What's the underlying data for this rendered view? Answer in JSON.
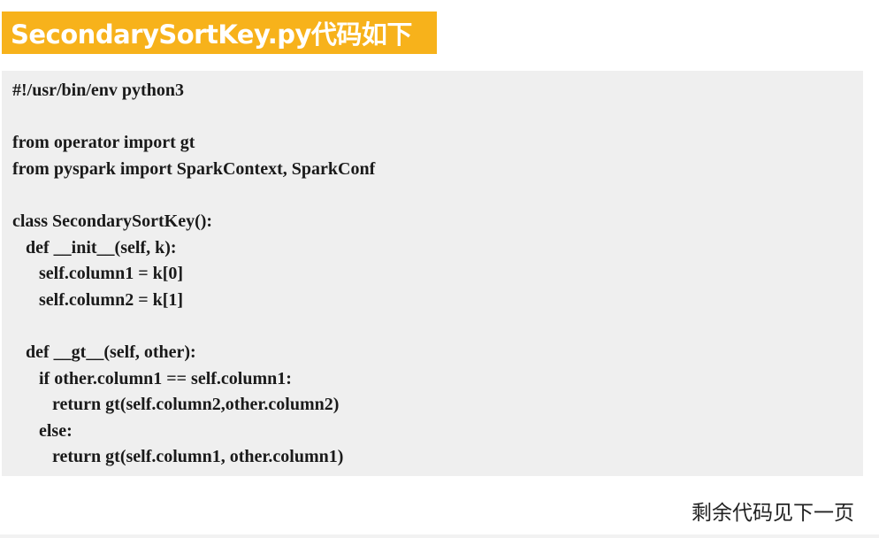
{
  "title": "SecondarySortKey.py代码如下",
  "code": {
    "lines": [
      "#!/usr/bin/env python3",
      "",
      "from operator import gt",
      "from pyspark import SparkContext, SparkConf",
      "",
      "class SecondarySortKey():",
      "   def __init__(self, k):",
      "      self.column1 = k[0]",
      "      self.column2 = k[1]",
      "",
      "   def __gt__(self, other):",
      "      if other.column1 == self.column1:",
      "         return gt(self.column2,other.column2)",
      "      else:",
      "         return gt(self.column1, other.column1)"
    ]
  },
  "footer_note": "剩余代码见下一页"
}
